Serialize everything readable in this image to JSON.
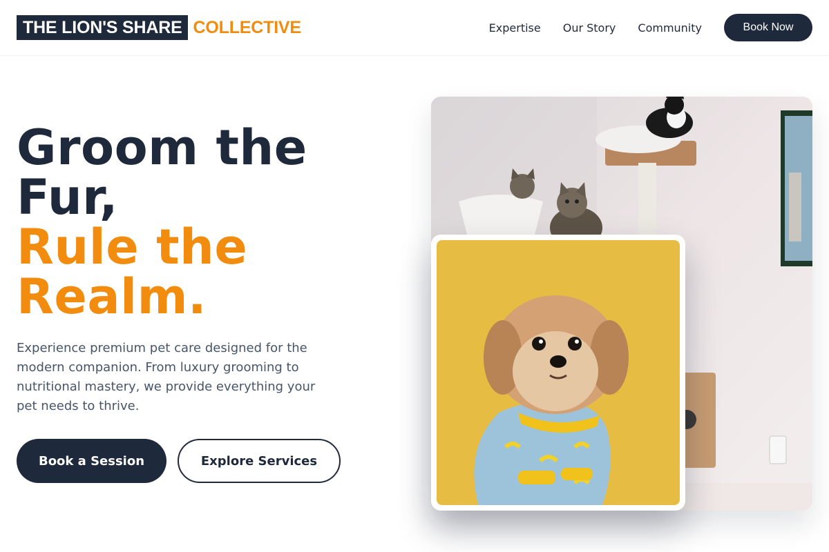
{
  "header": {
    "logo_primary": "THE LION'S SHARE",
    "logo_accent": "COLLECTIVE",
    "nav": [
      "Expertise",
      "Our Story",
      "Community"
    ],
    "cta": "Book Now"
  },
  "hero": {
    "title_line1": "Groom the",
    "title_line2": "Fur,",
    "title_line3": "Rule the",
    "title_line4": "Realm.",
    "description": "Experience premium pet care designed for the modern companion. From luxury grooming to nutritional mastery, we provide everything your pet needs to thrive.",
    "primary_button": "Book a Session",
    "secondary_button": "Explore Services"
  },
  "images": {
    "large": "cats-on-cat-tree-photo",
    "small": "dog-in-banana-pajamas-photo"
  },
  "colors": {
    "navy": "#1e293b",
    "accent": "#f28c0f",
    "body_text": "#475569"
  }
}
